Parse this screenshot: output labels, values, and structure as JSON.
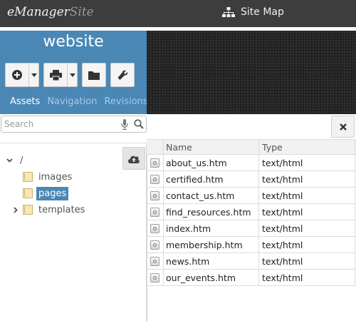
{
  "app": {
    "brand_main": "eManager",
    "brand_suffix": "Site",
    "page_title": "Site Map"
  },
  "panel": {
    "title": "website",
    "tabs": [
      "Assets",
      "Navigation",
      "Revisions"
    ],
    "active_tab": "Assets"
  },
  "search": {
    "placeholder": "Search"
  },
  "tree": {
    "root_label": "/",
    "items": [
      {
        "label": "images",
        "expanded": false,
        "selected": false
      },
      {
        "label": "pages",
        "expanded": false,
        "selected": true
      },
      {
        "label": "templates",
        "expanded": false,
        "selected": false,
        "has_children": true
      }
    ]
  },
  "files": {
    "columns": [
      "Name",
      "Type"
    ],
    "rows": [
      {
        "name": "about_us.htm",
        "type": "text/html"
      },
      {
        "name": "certified.htm",
        "type": "text/html"
      },
      {
        "name": "contact_us.htm",
        "type": "text/html"
      },
      {
        "name": "find_resources.htm",
        "type": "text/html"
      },
      {
        "name": "index.htm",
        "type": "text/html"
      },
      {
        "name": "membership.htm",
        "type": "text/html"
      },
      {
        "name": "news.htm",
        "type": "text/html"
      },
      {
        "name": "our_events.htm",
        "type": "text/html"
      }
    ]
  },
  "icons": {
    "toolbar": [
      "plus-circle-icon",
      "printer-icon",
      "folder-icon",
      "wrench-icon"
    ],
    "header": "sitemap-icon",
    "search": [
      "microphone-icon",
      "search-icon"
    ],
    "upload": "cloud-upload-icon",
    "close": "close-icon",
    "file": "file-icon"
  },
  "colors": {
    "topbar": "#3d3d3d",
    "panel_blue": "#4a87b5",
    "selected": "#4a87b5",
    "banner": "#222222"
  }
}
